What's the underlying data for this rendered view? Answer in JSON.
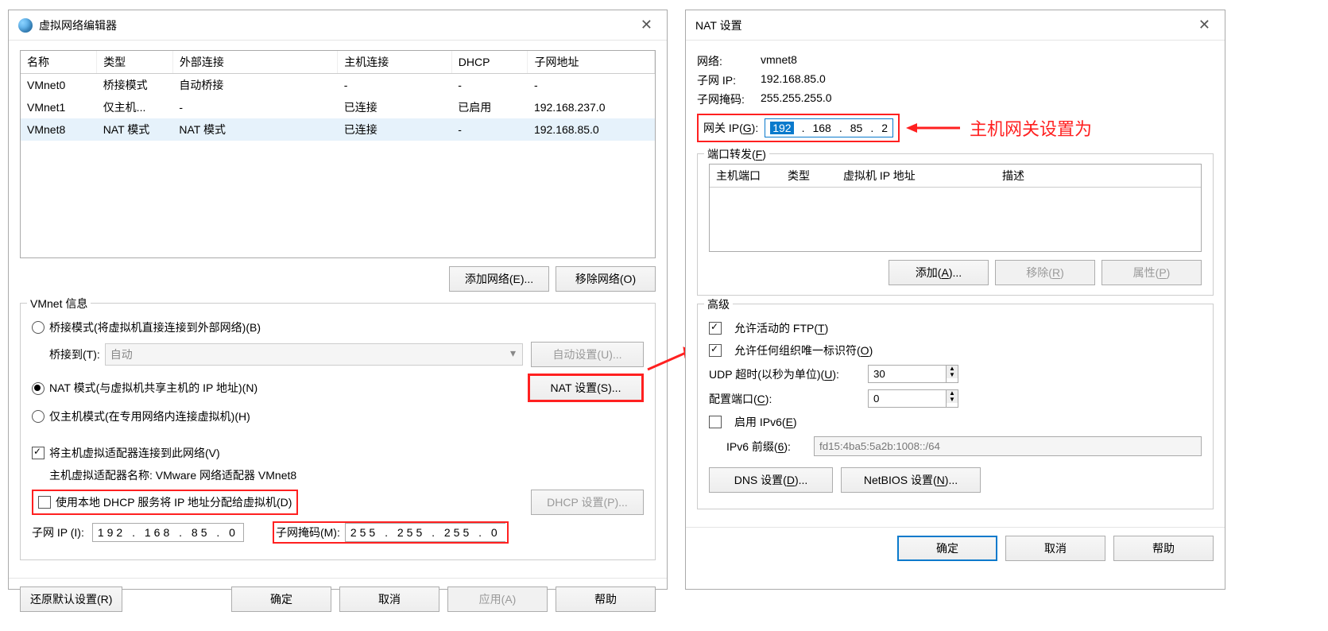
{
  "annotation": {
    "text": "主机网关设置为"
  },
  "w1": {
    "title": "虚拟网络编辑器",
    "cols": [
      "名称",
      "类型",
      "外部连接",
      "主机连接",
      "DHCP",
      "子网地址"
    ],
    "rows": [
      {
        "n": "VMnet0",
        "t": "桥接模式",
        "e": "自动桥接",
        "h": "-",
        "d": "-",
        "s": "-"
      },
      {
        "n": "VMnet1",
        "t": "仅主机...",
        "e": "-",
        "h": "已连接",
        "d": "已启用",
        "s": "192.168.237.0"
      },
      {
        "n": "VMnet8",
        "t": "NAT 模式",
        "e": "NAT 模式",
        "h": "已连接",
        "d": "-",
        "s": "192.168.85.0"
      }
    ],
    "addnet": "添加网络(E)...",
    "removenet": "移除网络(O)",
    "vmnetinfo": "VMnet 信息",
    "opt_bridge": "桥接模式(将虚拟机直接连接到外部网络)(B)",
    "bridge_to_label": "桥接到(T):",
    "bridge_to_value": "自动",
    "autoset": "自动设置(U)...",
    "opt_nat": "NAT 模式(与虚拟机共享主机的 IP 地址)(N)",
    "natset": "NAT 设置(S)...",
    "opt_hostonly": "仅主机模式(在专用网络内连接虚拟机)(H)",
    "chk_vhost": "将主机虚拟适配器连接到此网络(V)",
    "vhost_name_label": "主机虚拟适配器名称: VMware 网络适配器 VMnet8",
    "chk_dhcp": "使用本地 DHCP 服务将 IP 地址分配给虚拟机(D)",
    "dhcpset": "DHCP 设置(P)...",
    "subnetip_label": "子网 IP (I):",
    "subnetip_value": "192 . 168 .  85  .   0",
    "subnetmask_label": "子网掩码(M):",
    "subnetmask_value": "255 . 255 . 255 .   0",
    "restore": "还原默认设置(R)",
    "ok": "确定",
    "cancel": "取消",
    "apply": "应用(A)",
    "help": "帮助"
  },
  "w2": {
    "title": "NAT 设置",
    "net_k": "网络:",
    "net_v": "vmnet8",
    "sub_k": "子网 IP:",
    "sub_v": "192.168.85.0",
    "mask_k": "子网掩码:",
    "mask_v": "255.255.255.0",
    "gw_label": "网关 IP(G):",
    "gw_label_u": "G",
    "gw_oct": [
      "192",
      "168",
      "85",
      "2"
    ],
    "pf_title": "端口转发(F)",
    "pf_title_u": "F",
    "pf_cols": [
      "主机端口",
      "类型",
      "虚拟机 IP 地址",
      "描述"
    ],
    "add": "添加(A)...",
    "add_u": "A",
    "remove": "移除(R)",
    "remove_u": "R",
    "props": "属性(P)",
    "props_u": "P",
    "adv_title": "高级",
    "chk_ftp": "允许活动的 FTP(T)",
    "chk_ftp_u": "T",
    "chk_oui": "允许任何组织唯一标识符(O)",
    "chk_oui_u": "O",
    "udp_label": "UDP 超时(以秒为单位)(U):",
    "udp_u": "U",
    "udp_val": "30",
    "cfg_label": "配置端口(C):",
    "cfg_u": "C",
    "cfg_val": "0",
    "chk_ipv6": "启用 IPv6(E)",
    "chk_ipv6_u": "E",
    "ipv6p_label": "IPv6 前缀(6):",
    "ipv6p_u": "6",
    "ipv6p_val": "fd15:4ba5:5a2b:1008::/64",
    "dns": "DNS 设置(D)...",
    "dns_u": "D",
    "netbios": "NetBIOS 设置(N)...",
    "netbios_u": "N",
    "ok": "确定",
    "cancel": "取消",
    "help": "帮助"
  }
}
